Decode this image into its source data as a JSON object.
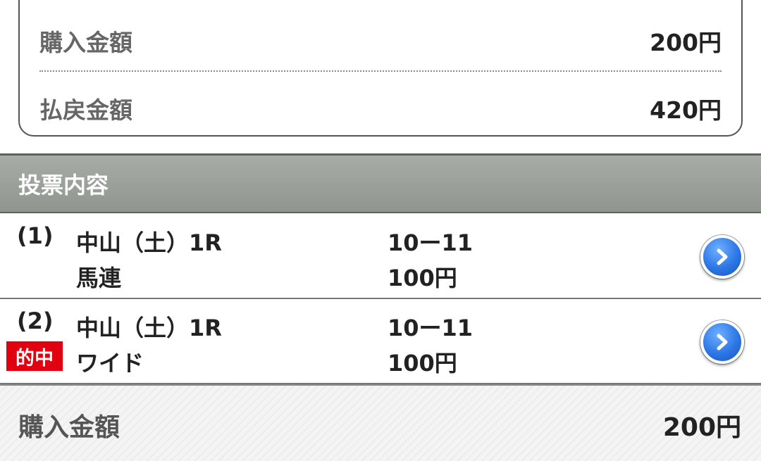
{
  "summary": {
    "purchase_label": "購入金額",
    "purchase_value": "200円",
    "payout_label": "払戻金額",
    "payout_value": "420円"
  },
  "bets_section": {
    "title": "投票内容",
    "items": [
      {
        "number": "(1)",
        "race": "中山（土）1R",
        "bet_type": "馬連",
        "combination": "10ー11",
        "amount": "100円",
        "badge": "",
        "action_icon": "chevron-right-icon"
      },
      {
        "number": "(2)",
        "race": "中山（土）1R",
        "bet_type": "ワイド",
        "combination": "10ー11",
        "amount": "100円",
        "badge": "的中",
        "action_icon": "chevron-right-icon"
      }
    ]
  },
  "footer": {
    "total_label": "購入金額",
    "total_value": "200円"
  },
  "colors": {
    "header_bg": "#9aa09a",
    "hit_badge": "#e00010",
    "action_button": "#2c77e6"
  }
}
